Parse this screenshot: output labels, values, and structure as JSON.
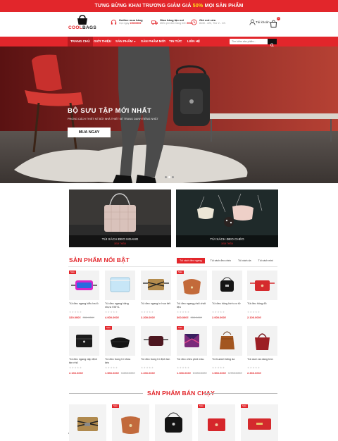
{
  "promo": {
    "pre": "TƯNG BỪNG KHAI TRƯƠNG GIẢM GIÁ",
    "highlight": "50%",
    "post": "MỌI SẢN PHẨM"
  },
  "brand": {
    "logo_main": "COOL",
    "logo_accent": "BAGS"
  },
  "header": {
    "hotline_title": "Hotline mua hàng",
    "hotline_text": "Gọi ngay",
    "hotline_number": "19006969",
    "ship_title": "Giao hàng tận nơi",
    "ship_text": "Miễn phí đơn hàng trên",
    "ship_amount": "500K",
    "hours_title": "Giờ mở cửa",
    "hours_text": "8h30 - 22h, Thứ 2 - CN",
    "account_label": "Tài khoản",
    "cart_count": "0"
  },
  "nav": {
    "items": [
      "TRANG CHỦ",
      "GIỚI THIỆU",
      "SẢN PHẨM",
      "SẢN PHẨM MỚI",
      "TIN TỨC",
      "LIÊN HỆ"
    ],
    "search_placeholder": "Tìm kiếm sản phẩm..."
  },
  "hero": {
    "title": "BỘ SƯU TẬP MỚI NHẤT",
    "subtitle": "PHONG CÁCH THIẾT KẾ BỞI NHÀ THIẾT KẾ TRANG DANH TIẾNG NHẤT",
    "cta": "MUA NGAY"
  },
  "banners": [
    {
      "label": "TÚI XÁCH ĐEO NGANG",
      "link": "XEM THÊM"
    },
    {
      "label": "TÚI XÁCH ĐEO CHÉO",
      "link": "XEM THÊM"
    }
  ],
  "featured": {
    "title": "SẢN PHẨM NỔI BẬT",
    "tabs": [
      "Túi xách đeo ngang",
      "Túi xách đeo chéo",
      "Túi xách da",
      "Túi xách mini"
    ]
  },
  "products": [
    {
      "name": "Túi đeo ngang kiểu ba lô",
      "price": "320.000₫",
      "old_price": "350.000₫",
      "sale": "Sale"
    },
    {
      "name": "Túi đeo ngang bằng nhựa VINYL",
      "price": "4.000.000₫",
      "old_price": "",
      "sale": ""
    },
    {
      "name": "Túi đeo ngang in hoa tiết",
      "price": "2.200.000₫",
      "old_price": "",
      "sale": ""
    },
    {
      "name": "Túi đeo ngang phối chất liệu",
      "price": "300.000₫",
      "old_price": "350.000₫",
      "sale": "Sale"
    },
    {
      "name": "Túi đeo hông hình cư tử",
      "price": "2.000.000₫",
      "old_price": "",
      "sale": ""
    },
    {
      "name": "Túi đeo hông đỏ",
      "price": "2.100.000₫",
      "old_price": "",
      "sale": ""
    },
    {
      "name": "Túi đeo ngang dập định tán nhỏ",
      "price": "2.100.000₫",
      "old_price": "",
      "sale": ""
    },
    {
      "name": "Túi đeo trong trí khóa kéo",
      "price": "1.500.000₫",
      "old_price": "1.800.000₫",
      "sale": "Sale"
    },
    {
      "name": "Túi đeo trong trí định tán",
      "price": "1.200.000₫",
      "old_price": "",
      "sale": ""
    },
    {
      "name": "Túi đeo chéo phối màu",
      "price": "1.900.000₫",
      "old_price": "2.000.000₫",
      "sale": "Sale"
    },
    {
      "name": "Túi bucket bằng da",
      "price": "1.500.000₫",
      "old_price": "1.700.000₫",
      "sale": ""
    },
    {
      "name": "Túi xách da dáng tròn",
      "price": "2.300.000₫",
      "old_price": "",
      "sale": ""
    }
  ],
  "best": {
    "title": "SẢN PHẨM BÁN CHẠY",
    "sale": "Sale"
  }
}
